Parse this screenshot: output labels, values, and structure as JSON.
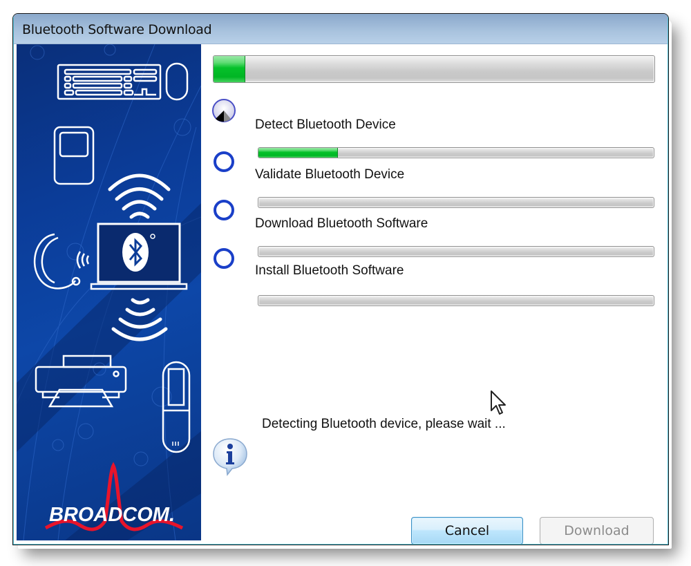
{
  "window": {
    "title": "Bluetooth Software Download"
  },
  "sidebar": {
    "brand_logo_text": "BROADCOM.",
    "illustrations": [
      "keyboard-icon",
      "mouse-icon",
      "media-player-icon",
      "wireless-signal-icon",
      "headset-icon",
      "laptop-bluetooth-icon",
      "printer-icon",
      "mobile-phone-icon"
    ]
  },
  "progress": {
    "overall_percent": 7,
    "steps": [
      {
        "label": "Detect Bluetooth Device",
        "status": "in-progress",
        "icon": "busy-spinner-icon",
        "percent": 20
      },
      {
        "label": "Validate Bluetooth Device",
        "status": "pending",
        "icon": "pending-circle-icon",
        "percent": 0
      },
      {
        "label": "Download Bluetooth Software",
        "status": "pending",
        "icon": "pending-circle-icon",
        "percent": 0
      },
      {
        "label": "Install Bluetooth Software",
        "status": "pending",
        "icon": "pending-circle-icon",
        "percent": 0
      }
    ]
  },
  "status": {
    "message": "Detecting Bluetooth device, please wait ...",
    "icon": "info-icon"
  },
  "buttons": {
    "cancel_label": "Cancel",
    "download_label": "Download",
    "download_enabled": false
  },
  "colors": {
    "progress_green": "#06c12a",
    "step_ring_blue": "#1a3fc8",
    "sidebar_blue": "#0b3c98",
    "brand_red": "#e8142b"
  }
}
